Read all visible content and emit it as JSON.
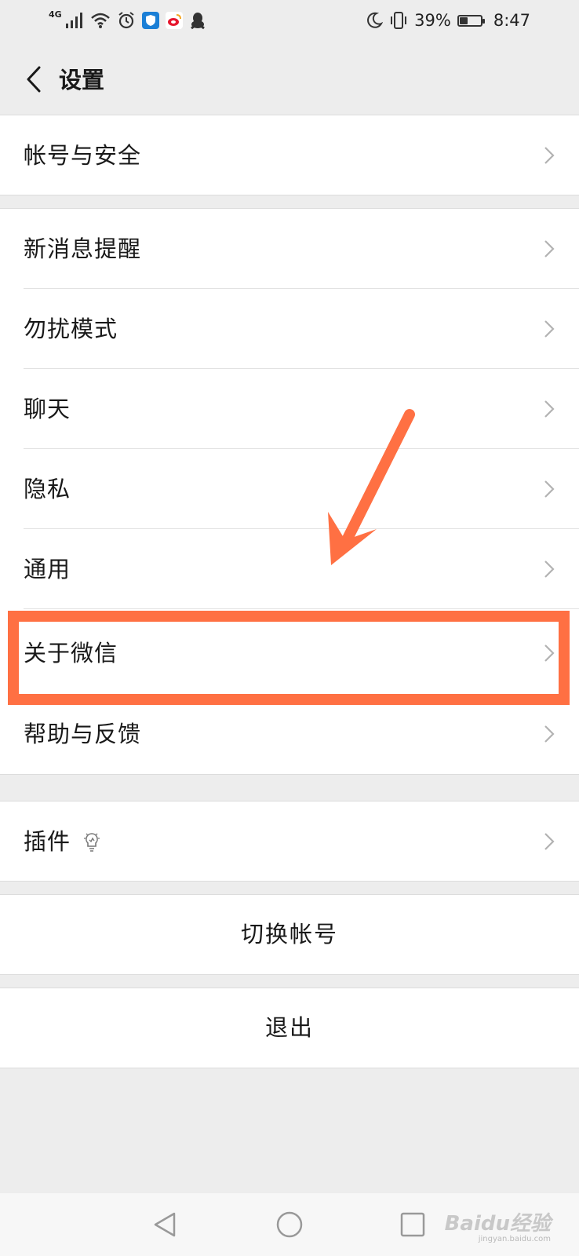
{
  "status_bar": {
    "network": "4G",
    "battery_percent": "39%",
    "battery_level": 0.39,
    "time": "8:47",
    "icons": [
      "signal-icon",
      "wifi-icon",
      "alarm-icon",
      "shield-app-icon",
      "weibo-app-icon",
      "qq-app-icon",
      "moon-icon",
      "vibrate-icon",
      "battery-icon"
    ]
  },
  "header": {
    "title": "设置",
    "back_icon": "chevron-left-icon"
  },
  "groups": {
    "account": {
      "items": [
        {
          "label": "帐号与安全"
        }
      ]
    },
    "main": {
      "items": [
        {
          "label": "新消息提醒"
        },
        {
          "label": "勿扰模式"
        },
        {
          "label": "聊天"
        },
        {
          "label": "隐私"
        },
        {
          "label": "通用"
        },
        {
          "label": "关于微信"
        },
        {
          "label": "帮助与反馈"
        }
      ]
    },
    "plugins": {
      "items": [
        {
          "label": "插件",
          "badge_icon": "lightbulb-icon"
        }
      ]
    }
  },
  "actions": {
    "switch_account": "切换帐号",
    "logout": "退出"
  },
  "annotation": {
    "color": "#ff7043",
    "highlighted_item": "关于微信"
  },
  "watermark": {
    "brand": "Baidu经验",
    "domain": "jingyan.baidu.com"
  },
  "colors": {
    "background": "#ededed",
    "card": "#ffffff",
    "text": "#191919",
    "chevron": "#b2b2b2"
  }
}
